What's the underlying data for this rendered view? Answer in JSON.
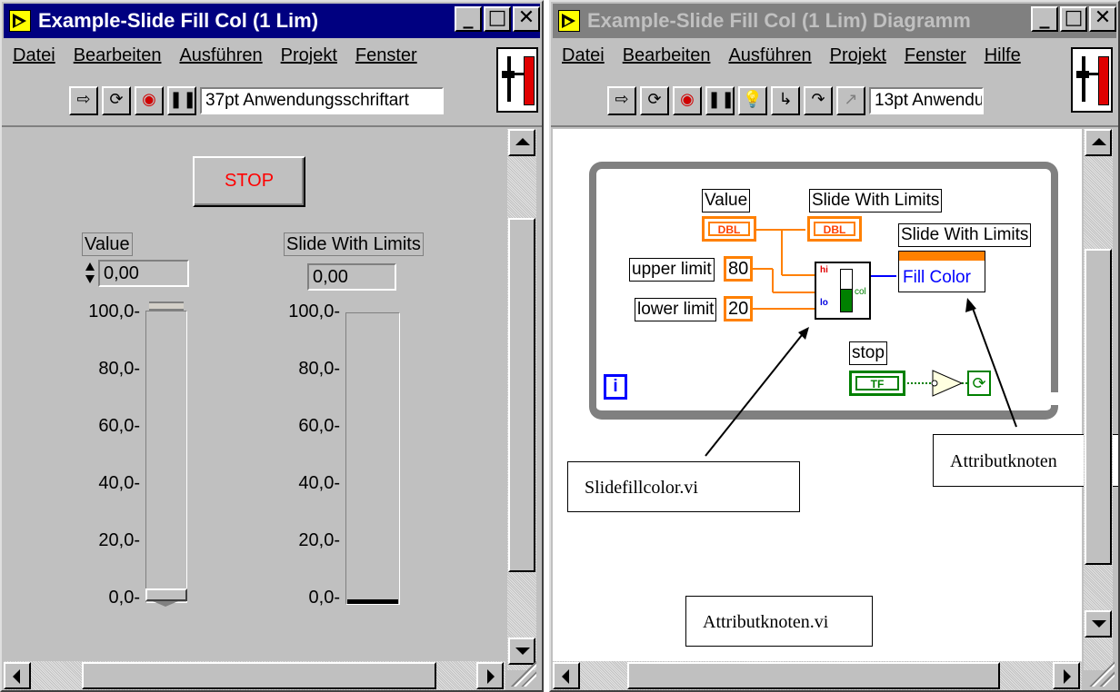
{
  "front_panel": {
    "title": "Example-Slide Fill Col (1 Lim)",
    "menu": [
      "Datei",
      "Bearbeiten",
      "Ausführen",
      "Projekt",
      "Fenster"
    ],
    "font_selector": "37pt Anwendungsschriftart",
    "stop_button": "STOP",
    "value_control": {
      "label": "Value",
      "value": "0,00"
    },
    "slide_indicator": {
      "label": "Slide With Limits",
      "value": "0,00"
    },
    "scale_left": [
      "100,0-",
      "80,0-",
      "60,0-",
      "40,0-",
      "20,0-",
      "0,0-"
    ],
    "scale_right": [
      "100,0-",
      "80,0-",
      "60,0-",
      "40,0-",
      "20,0-",
      "0,0-"
    ]
  },
  "diagram": {
    "title": "Example-Slide Fill Col (1 Lim) Diagramm",
    "menu": [
      "Datei",
      "Bearbeiten",
      "Ausführen",
      "Projekt",
      "Fenster",
      "Hilfe"
    ],
    "font_selector": "13pt Anwendu",
    "value_label": "Value",
    "slide_label": "Slide With Limits",
    "dbl_tag": "DBL",
    "node_label": "Slide With Limits",
    "fill_color": "Fill Color",
    "upper_limit_label": "upper limit",
    "upper_limit_value": "80",
    "lower_limit_label": "lower limit",
    "lower_limit_value": "20",
    "stop_label": "stop",
    "tf_tag": "TF",
    "loop_index": "i",
    "subvi_hi": "hi",
    "subvi_lo": "lo",
    "subvi_col": "col"
  },
  "annotations": {
    "callout_subvi": "Slidefillcolor.vi",
    "callout_node": "Attributknoten",
    "callout_file": "Attributknoten.vi"
  },
  "colors": {
    "titlebar_active": "#000080",
    "numeric_wire": "#ff8000",
    "boolean_wire": "#008000",
    "stop_text": "#ff0000"
  }
}
